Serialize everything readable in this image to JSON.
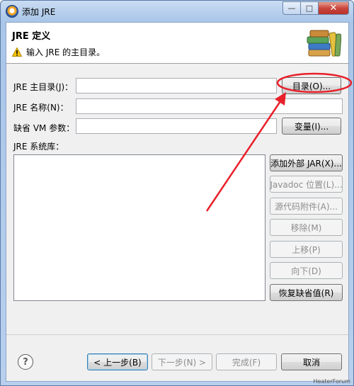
{
  "window": {
    "title": "添加 JRE",
    "close_glyph": "✕",
    "minimize_glyph": "—",
    "maximize_glyph": "□"
  },
  "header": {
    "title": "JRE 定义",
    "message": "输入 JRE 的主目录。",
    "message_icon": "warning-icon",
    "banner_icon": "books-icon"
  },
  "form": {
    "home_label": "JRE 主目录(J)：",
    "home_value": "",
    "directory_button": "目录(O)...",
    "name_label": "JRE 名称(N)：",
    "name_value": "",
    "vm_args_label": "缺省 VM 参数：",
    "vm_args_value": "",
    "variables_button": "变量(I)...",
    "libraries_label": "JRE 系统库："
  },
  "library_buttons": [
    {
      "label": "添加外部 JAR(X)...",
      "enabled": true
    },
    {
      "label": "Javadoc 位置(L)...",
      "enabled": false
    },
    {
      "label": "源代码附件(A)...",
      "enabled": false
    },
    {
      "label": "移除(M)",
      "enabled": false
    },
    {
      "label": "上移(P)",
      "enabled": false
    },
    {
      "label": "向下(D)",
      "enabled": false
    },
    {
      "label": "恢复缺省值(R)",
      "enabled": true
    }
  ],
  "footer": {
    "help_glyph": "?",
    "back": "< 上一步(B)",
    "next": "下一步(N) >",
    "finish": "完成(F)",
    "cancel": "取消"
  },
  "annotation_color": "#e8202a",
  "watermark": "HeaterForum"
}
